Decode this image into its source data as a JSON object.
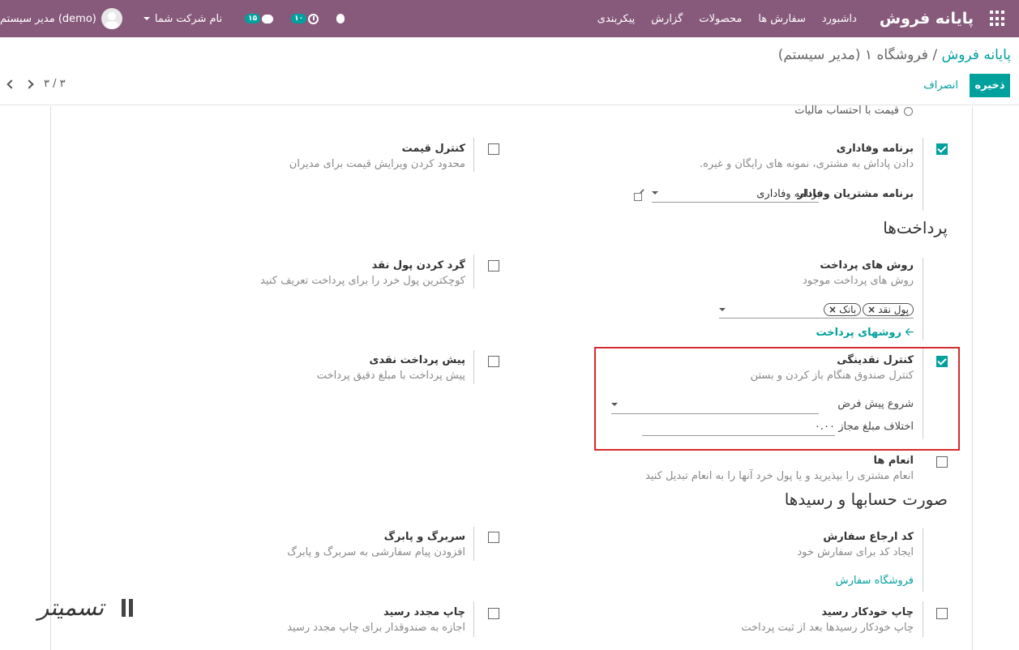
{
  "navbar": {
    "brand": "پایانه فروش",
    "menu": [
      "داشبورد",
      "سفارش ها",
      "محصولات",
      "گزارش",
      "پیکربندی"
    ],
    "chat_count": "۱۵",
    "activity_count": "۱۰",
    "company": "نام شرکت شما",
    "user": "مدیر سیستم (demo)"
  },
  "control": {
    "breadcrumb_root": "پایانه فروش",
    "breadcrumb_sep": "/",
    "breadcrumb_current": "فروشگاه ۱ (مدیر سیستم)",
    "save": "ذخیره",
    "cancel": "انصراف",
    "pager": "۳ / ۳"
  },
  "settings": {
    "tax_included_label": "قیمت با احتساب مالیات",
    "loyalty": {
      "title": "برنامه وفاداری",
      "desc": "دادن پاداش به مشتری، نمونه های رایگان و غیره.",
      "field_label": "برنامه مشتریان وفادار",
      "field_value": "برنامه وفاداری",
      "checked": true
    },
    "price_control": {
      "title": "کنترل قیمت",
      "desc": "محدود کردن ویرایش قیمت برای مدیران",
      "checked": false
    },
    "payments_section": "پرداخت‌ها",
    "payment_methods": {
      "title": "روش های پرداخت",
      "desc": "روش های پرداخت موجود",
      "tags": [
        "پول نقد",
        "بانک"
      ],
      "link": "روشهای پرداخت",
      "arrow": "🡠"
    },
    "cash_rounding": {
      "title": "گرد کردن پول نقد",
      "desc": "کوچکترین پول خرد را برای پرداخت تعریف کنید",
      "checked": false
    },
    "cash_control": {
      "title": "کنترل نقدینگی",
      "desc": "کنترل صندوق هنگام باز کردن و بستن",
      "default_opening_label": "شروع پیش فرض",
      "tolerance_label": "اختلاف مبلغ مجاز",
      "tolerance_value": "۰.۰۰",
      "checked": true
    },
    "prepayment": {
      "title": "پیش پرداخت نقدی",
      "desc": "پیش پرداخت با مبلغ دقیق پرداخت",
      "checked": false
    },
    "tips": {
      "title": "انعام ها",
      "desc": "انعام مشتری را بپذیرید و یا پول خرد آنها را به انعام تبدیل کنید",
      "checked": false
    },
    "bills_section": "صورت حسابها و رسیدها",
    "order_reference": {
      "title": "کد ارجاع سفارش",
      "desc": "ایجاد کد برای سفارش خود",
      "link": "فروشگاه سفارش"
    },
    "header_footer": {
      "title": "سربرگ و پابرگ",
      "desc": "افزودن پیام سفارشی به سربرگ و پابرگ",
      "checked": false
    },
    "auto_print": {
      "title": "چاپ خودکار رسید",
      "desc": "چاپ خودکار رسیدها بعد از ثبت پرداخت",
      "checked": false
    },
    "reprint": {
      "title": "چاپ مجدد رسید",
      "desc": "اجازه به صندوقدار برای چاپ مجدد رسید",
      "checked": false
    }
  },
  "watermark": {
    "text": "تسمیتر"
  }
}
